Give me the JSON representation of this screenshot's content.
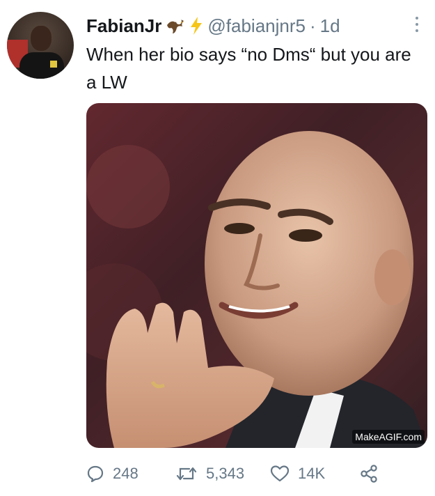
{
  "tweet": {
    "display_name": "FabianJr",
    "name_emojis": [
      "eagle-emoji",
      "lightning-emoji"
    ],
    "handle": "@fabianjnr5",
    "separator": "·",
    "time": "1d",
    "text": "When her bio says “no Dms“ but you are a LW",
    "media": {
      "watermark": "MakeAGIF.com"
    }
  },
  "actions": {
    "reply_count": "248",
    "retweet_count": "5,343",
    "like_count": "14K"
  },
  "colors": {
    "text": "#14171a",
    "secondary": "#657786",
    "lightning": "#f5c518"
  }
}
